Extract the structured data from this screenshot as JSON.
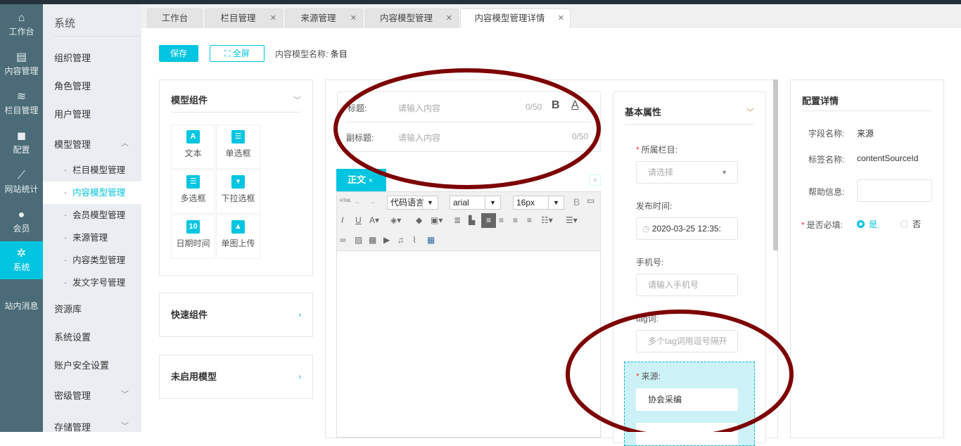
{
  "nav": [
    {
      "icon": "home-icon",
      "label": "工作台"
    },
    {
      "icon": "document-icon",
      "label": "内容管理"
    },
    {
      "icon": "layers-icon",
      "label": "栏目管理"
    },
    {
      "icon": "cube-icon",
      "label": "配置"
    },
    {
      "icon": "chart-line-icon",
      "label": "网站统计"
    },
    {
      "icon": "user-icon",
      "label": "会员"
    },
    {
      "icon": "gear-icon",
      "label": "系统"
    },
    {
      "label": "站内消息"
    }
  ],
  "sub": {
    "title": "系统",
    "items": [
      "组织管理",
      "角色管理",
      "用户管理",
      "模型管理"
    ],
    "children": [
      "栏目模型管理",
      "内容模型管理",
      "会员模型管理",
      "来源管理",
      "内容类型管理",
      "发文字号管理"
    ],
    "items2": [
      "资源库",
      "系统设置",
      "账户安全设置",
      "密级管理",
      "存储管理"
    ]
  },
  "tabs": [
    "工作台",
    "栏目管理",
    "来源管理",
    "内容模型管理",
    "内容模型管理详情"
  ],
  "toolbar": {
    "save": "保存",
    "fullscreen": "全屏",
    "model_name_label": "内容模型名称:",
    "model_name": "条目"
  },
  "components": {
    "title": "模型组件",
    "items": [
      "文本",
      "单选框",
      "多选框",
      "下拉选框",
      "日期时间",
      "单图上传"
    ],
    "quick": "快速组件",
    "unused": "未启用模型"
  },
  "editor": {
    "title_label": "标题:",
    "subtitle_label": "副标题:",
    "placeholder": "请输入内容",
    "count": "0/50",
    "bold": "B",
    "fontcolor": "A",
    "body_tab": "正文",
    "close": "×",
    "plus": "+",
    "html": "HTML",
    "code_lang": "代码语言",
    "font": "arial",
    "size": "16px"
  },
  "basic": {
    "title": "基本属性",
    "column_label": "所属栏目:",
    "column_placeholder": "请选择",
    "time_label": "发布时间:",
    "time_value": "2020-03-25 12:35:",
    "phone_label": "手机号:",
    "phone_placeholder": "请输入手机号",
    "tag_label": "tag词:",
    "tag_placeholder": "多个tag词用逗号隔开",
    "source_label": "来源:",
    "source_value": "协会采编"
  },
  "config": {
    "title": "配置详情",
    "field_name_label": "字段名称:",
    "field_name": "来源",
    "tag_name_label": "标签名称:",
    "tag_name": "contentSourceId",
    "help_label": "帮助信息:",
    "required_label": "是否必填:",
    "yes": "是",
    "no": "否"
  },
  "colors": {
    "accent": "#00c5e0",
    "annotation": "#7d0000"
  }
}
